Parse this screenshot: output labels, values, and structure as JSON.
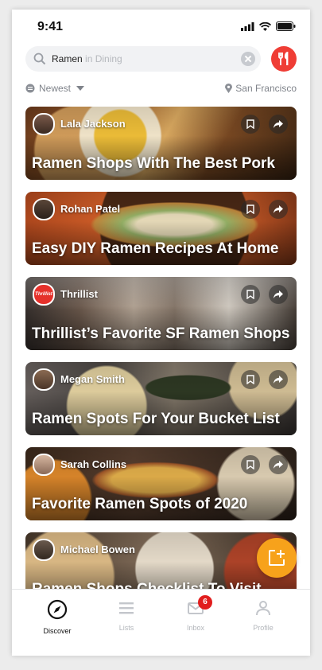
{
  "status_bar": {
    "time": "9:41"
  },
  "search": {
    "query": "Ramen",
    "scope": "in Dining"
  },
  "filters": {
    "sort": "Newest",
    "location": "San Francisco"
  },
  "cards": [
    {
      "author": "Lala Jackson",
      "title": "Ramen Shops With The Best Pork"
    },
    {
      "author": "Rohan Patel",
      "title": "Easy DIY Ramen Recipes At Home"
    },
    {
      "author": "Thrillist",
      "title": "Thrillist’s Favorite SF Ramen Shops",
      "avatar_text": "Thrillist"
    },
    {
      "author": "Megan Smith",
      "title": "Ramen Spots For Your Bucket List"
    },
    {
      "author": "Sarah Collins",
      "title": "Favorite Ramen Spots of 2020"
    },
    {
      "author": "Michael Bowen",
      "title": "Ramen Shops Checklist To Visit"
    }
  ],
  "tabbar": {
    "discover": "Discover",
    "lists": "Lists",
    "inbox": "Inbox",
    "inbox_badge": "6",
    "profile": "Profile"
  },
  "colors": {
    "accent": "#ef3d35",
    "fab": "#f7a21b",
    "badge": "#e11d1d"
  }
}
